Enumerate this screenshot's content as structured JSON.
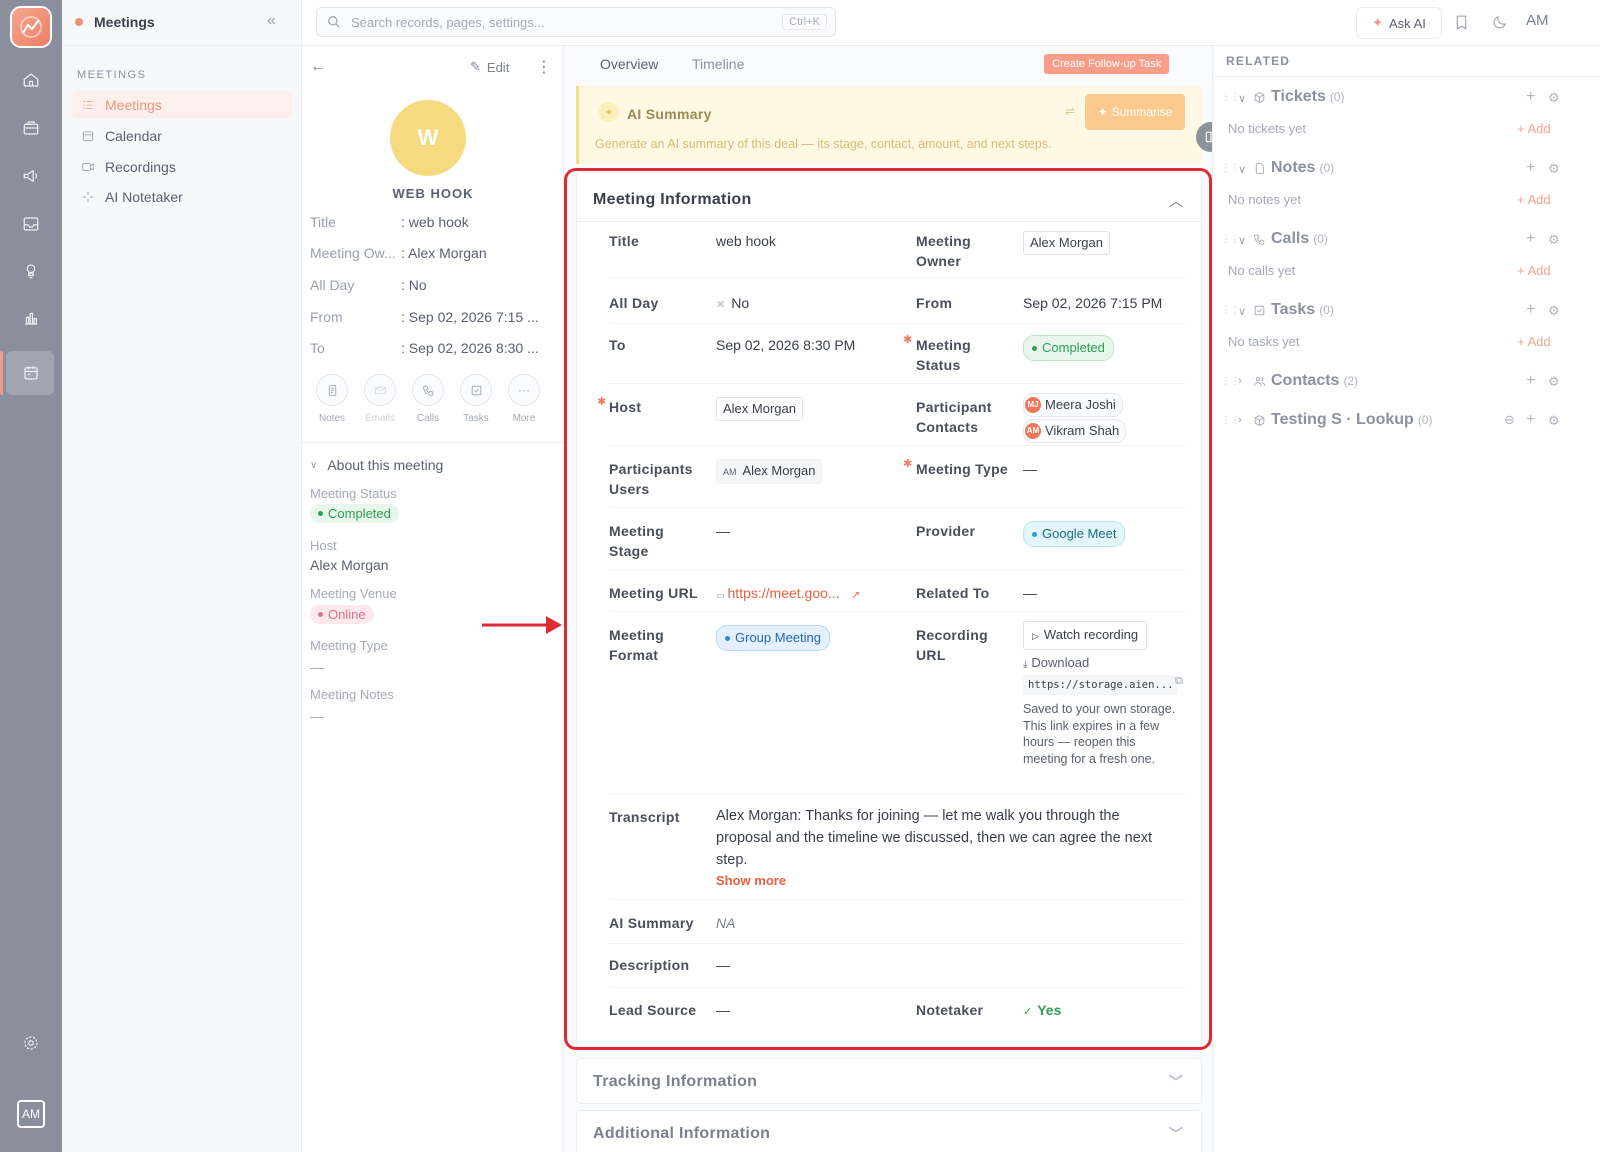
{
  "app": {
    "title": "Meetings",
    "user_initials": "AM"
  },
  "nav": {
    "section": "MEETINGS",
    "items": [
      {
        "label": "Meetings",
        "active": true
      },
      {
        "label": "Calendar"
      },
      {
        "label": "Recordings"
      },
      {
        "label": "AI Notetaker"
      }
    ]
  },
  "topbar": {
    "search_placeholder": "Search records, pages, settings...",
    "shortcut": "Ctrl+K",
    "ask_ai": "Ask AI",
    "avatar": "AM"
  },
  "record": {
    "edit_label": "Edit",
    "avatar_letter": "W",
    "name": "WEB HOOK",
    "fields": [
      {
        "k": "Title",
        "v": ": web hook"
      },
      {
        "k": "Meeting Ow...",
        "v": ": Alex Morgan"
      },
      {
        "k": "All Day",
        "v": ": No"
      },
      {
        "k": "From",
        "v": ": Sep 02, 2026 7:15 ..."
      },
      {
        "k": "To",
        "v": ": Sep 02, 2026 8:30 ..."
      }
    ],
    "actions": [
      "Notes",
      "Emails",
      "Calls",
      "Tasks",
      "More"
    ],
    "about_title": "About this meeting",
    "about": {
      "status_label": "Meeting Status",
      "status_value": "Completed",
      "host_label": "Host",
      "host_value": "Alex Morgan",
      "venue_label": "Meeting Venue",
      "venue_value": "Online",
      "type_label": "Meeting Type",
      "type_value": "—",
      "notes_label": "Meeting Notes",
      "notes_value": "—"
    }
  },
  "center": {
    "tabs": [
      "Overview",
      "Timeline"
    ],
    "followup_button": "Create Follow-up Task",
    "ai_summary": {
      "title": "AI Summary",
      "button": "Summarise",
      "description": "Generate an AI summary of this deal — its stage, contact, amount, and next steps."
    },
    "card_title": "Meeting Information",
    "fields": {
      "title_l": "Title",
      "title_v": "web hook",
      "owner_l1": "Meeting",
      "owner_l2": "Owner",
      "owner_v": "Alex Morgan",
      "allday_l": "All Day",
      "allday_v": "No",
      "from_l": "From",
      "from_v": "Sep 02, 2026 7:15 PM",
      "to_l": "To",
      "to_v": "Sep 02, 2026 8:30 PM",
      "status_l1": "Meeting",
      "status_l2": "Status",
      "status_v": "Completed",
      "host_l": "Host",
      "host_v": "Alex Morgan",
      "pc_l1": "Participant",
      "pc_l2": "Contacts",
      "pc_1_initials": "MJ",
      "pc_1": "Meera Joshi",
      "pc_2_initials": "AM",
      "pc_2": "Vikram Shah",
      "pu_l1": "Participants",
      "pu_l2": "Users",
      "pu_initials": "AM",
      "pu_v": "Alex Morgan",
      "mtype_l": "Meeting Type",
      "mtype_v": "—",
      "stage_l1": "Meeting",
      "stage_l2": "Stage",
      "stage_v": "—",
      "provider_l": "Provider",
      "provider_v": "Google Meet",
      "url_l": "Meeting URL",
      "url_v": "https://meet.goo...",
      "related_l": "Related To",
      "related_v": "—",
      "format_l1": "Meeting",
      "format_l2": "Format",
      "format_v": "Group Meeting",
      "rec_l1": "Recording",
      "rec_l2": "URL",
      "rec_watch": "Watch recording",
      "rec_download": "Download",
      "rec_link": "https://storage.aien...",
      "rec_note": "Saved to your own storage. This link expires in a few hours — reopen this meeting for a fresh one.",
      "transcript_l": "Transcript",
      "transcript_v": "Alex Morgan: Thanks for joining — let me walk you through the proposal and the timeline we discussed, then we can agree the next step.",
      "show_more": "Show more",
      "aisum_l": "AI Summary",
      "aisum_v": "NA",
      "desc_l": "Description",
      "desc_v": "—",
      "lead_l": "Lead Source",
      "lead_v": "—",
      "notetaker_l": "Notetaker",
      "notetaker_v": "Yes"
    },
    "tracking_title": "Tracking Information",
    "additional_title": "Additional Information"
  },
  "related": {
    "header": "RELATED",
    "sections": [
      {
        "title": "Tickets",
        "count": "(0)",
        "empty": "No tickets yet",
        "add": "+ Add"
      },
      {
        "title": "Notes",
        "count": "(0)",
        "empty": "No notes yet",
        "add": "+ Add"
      },
      {
        "title": "Calls",
        "count": "(0)",
        "empty": "No calls yet",
        "add": "+ Add"
      },
      {
        "title": "Tasks",
        "count": "(0)",
        "empty": "No tasks yet",
        "add": "+ Add"
      },
      {
        "title": "Contacts",
        "count": "(2)"
      },
      {
        "title": "Testing S · Lookup",
        "count": "(0)"
      }
    ]
  },
  "colors": {
    "accent": "#f3957f",
    "highlight": "#dd2a37",
    "rail": "#8a8f9e"
  }
}
